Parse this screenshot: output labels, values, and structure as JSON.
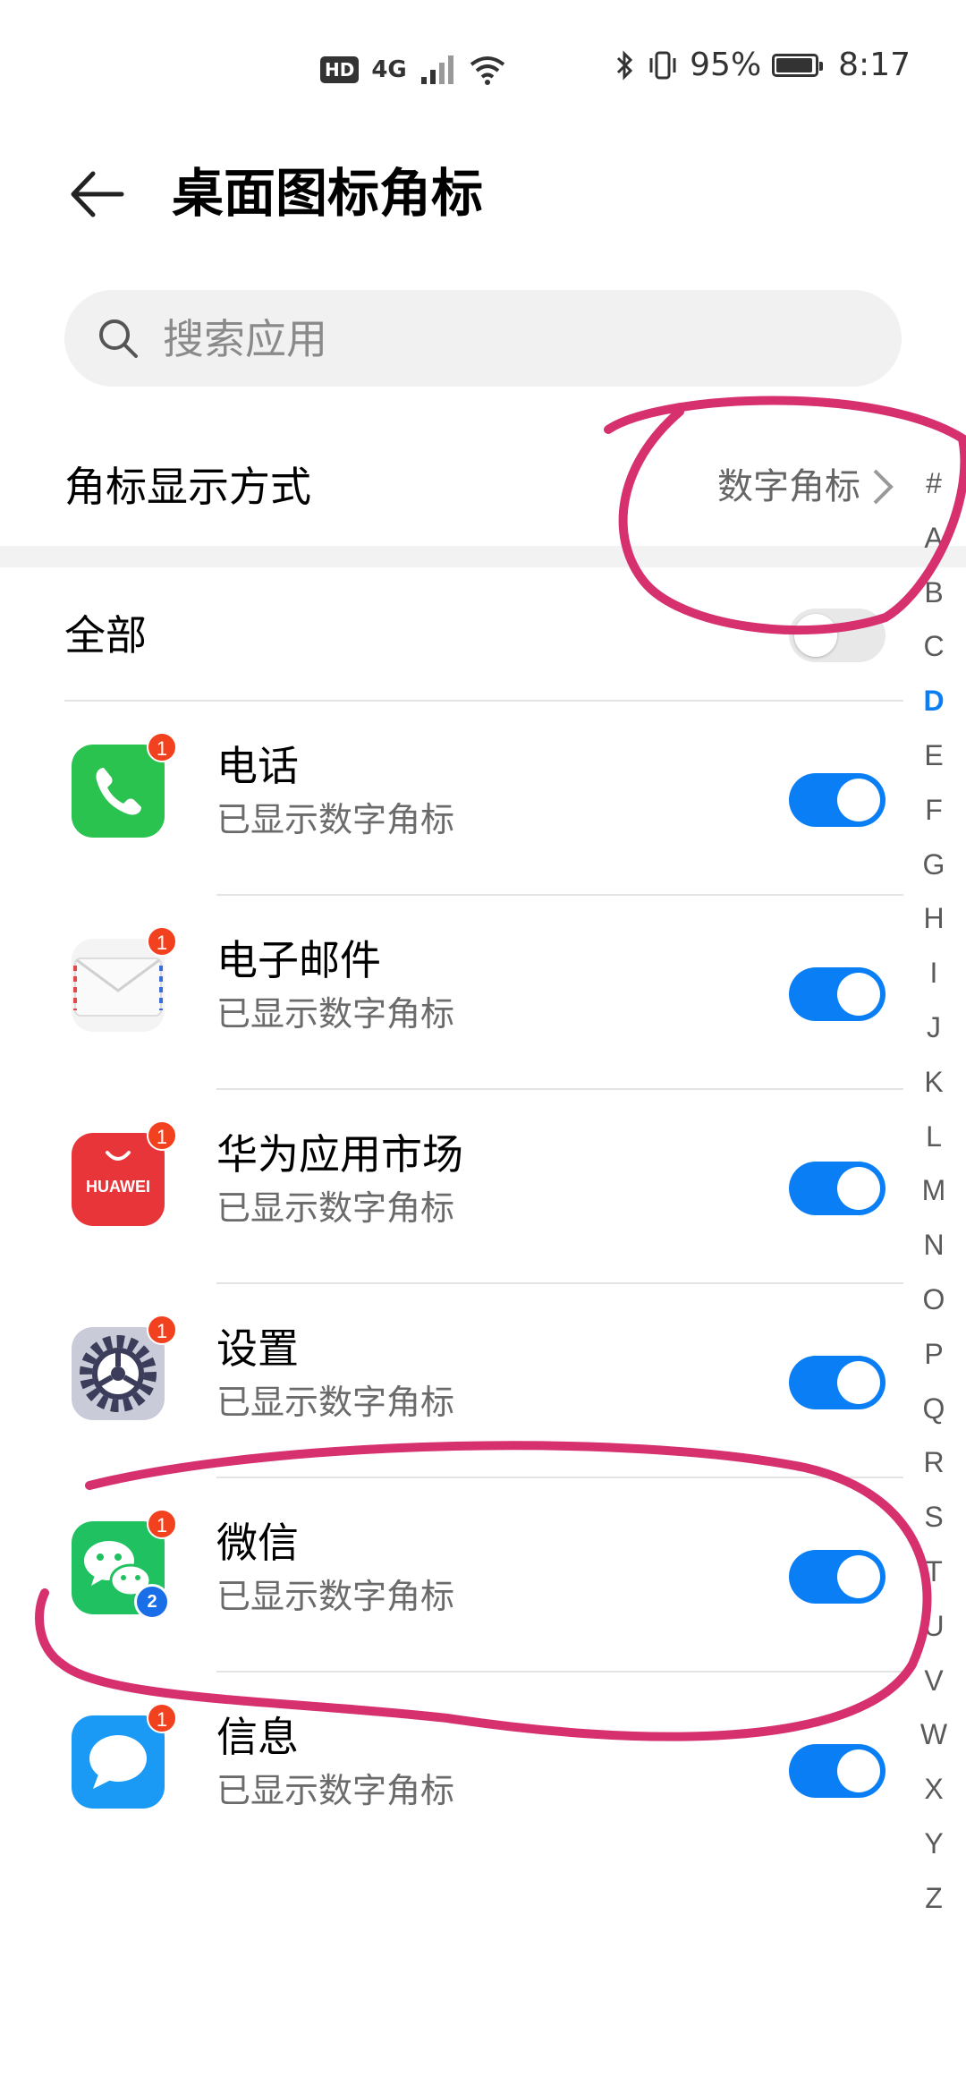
{
  "status_bar": {
    "hd_label": "HD",
    "network_label": "4G",
    "battery_text": "95%",
    "battery_level": 0.95,
    "time": "8:17"
  },
  "header": {
    "title": "桌面图标角标"
  },
  "search": {
    "placeholder": "搜索应用"
  },
  "badge_mode": {
    "label": "角标显示方式",
    "value": "数字角标"
  },
  "all": {
    "label": "全部",
    "enabled": false
  },
  "apps": [
    {
      "name": "电话",
      "status": "已显示数字角标",
      "badge": "1",
      "enabled": true,
      "icon": "phone-icon"
    },
    {
      "name": "电子邮件",
      "status": "已显示数字角标",
      "badge": "1",
      "enabled": true,
      "icon": "email-icon"
    },
    {
      "name": "华为应用市场",
      "status": "已显示数字角标",
      "badge": "1",
      "enabled": true,
      "icon": "huawei-appgallery-icon",
      "icon_text": "HUAWEI"
    },
    {
      "name": "设置",
      "status": "已显示数字角标",
      "badge": "1",
      "enabled": true,
      "icon": "settings-gear-icon"
    },
    {
      "name": "微信",
      "status": "已显示数字角标",
      "badge": "1",
      "enabled": true,
      "icon": "wechat-icon",
      "clone_badge": "2"
    },
    {
      "name": "信息",
      "status": "已显示数字角标",
      "badge": "1",
      "enabled": true,
      "icon": "messages-icon"
    }
  ],
  "index_letters": [
    "#",
    "A",
    "B",
    "C",
    "D",
    "E",
    "F",
    "G",
    "H",
    "I",
    "J",
    "K",
    "L",
    "M",
    "N",
    "O",
    "P",
    "Q",
    "R",
    "S",
    "T",
    "U",
    "V",
    "W",
    "X",
    "Y",
    "Z"
  ],
  "index_active": "D",
  "colors": {
    "accent": "#0a7ff5",
    "badge_red": "#f2411f",
    "annotation": "#d6306f",
    "phone_green": "#2ac34f",
    "wechat_green": "#20c160",
    "huawei_red": "#e8353a",
    "messages_blue": "#1a9af5"
  }
}
